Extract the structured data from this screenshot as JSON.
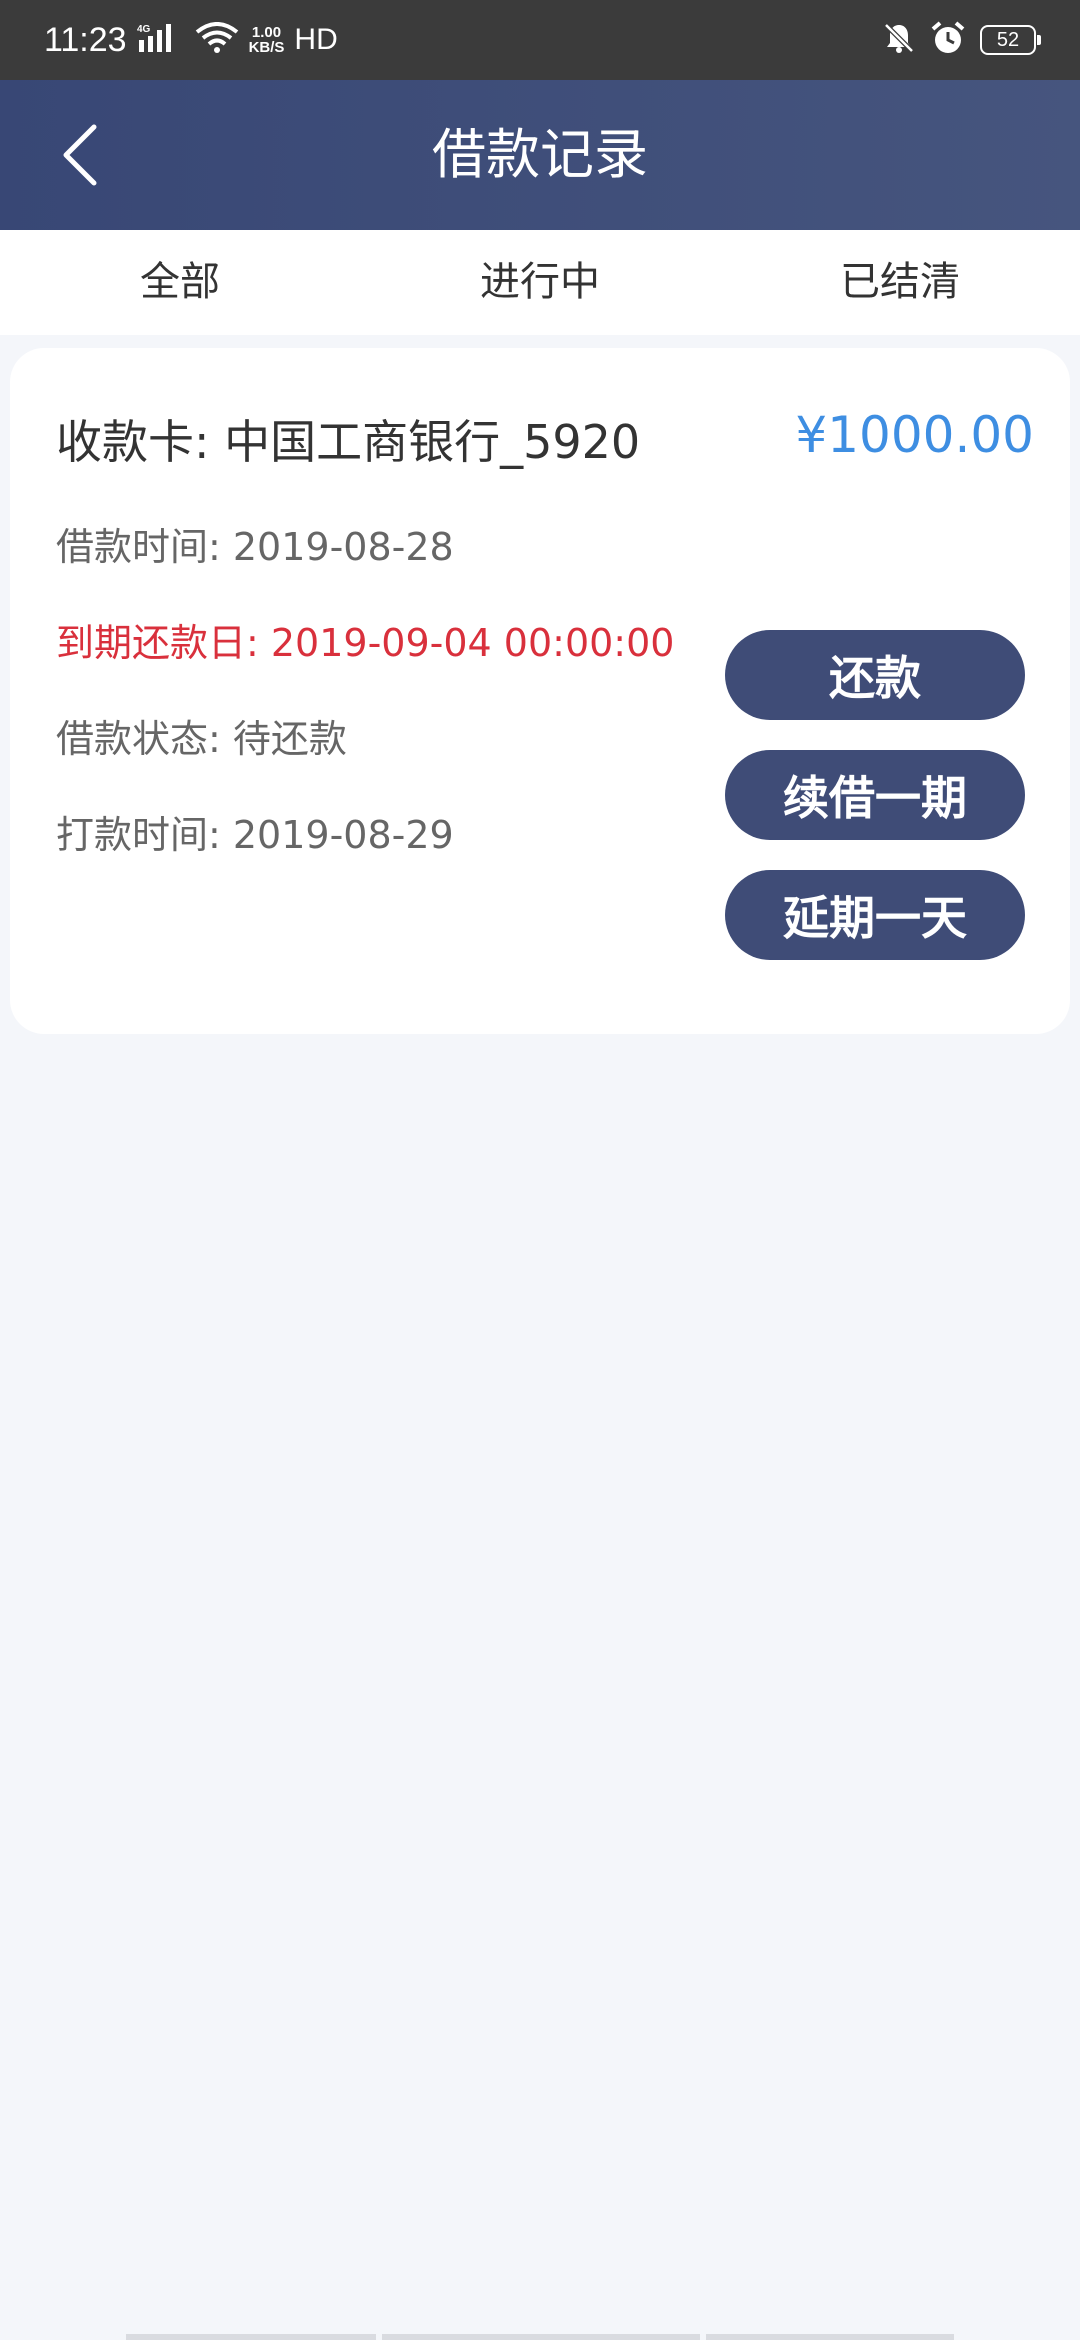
{
  "status_bar": {
    "time": "11:23",
    "network_type": "4G",
    "speed_value": "1.00",
    "speed_unit": "KB/S",
    "hd": "HD",
    "battery": "52"
  },
  "header": {
    "title": "借款记录"
  },
  "tabs": [
    {
      "label": "全部"
    },
    {
      "label": "进行中"
    },
    {
      "label": "已结清"
    }
  ],
  "record": {
    "card_label": "收款卡: 中国工商银行_5920",
    "amount": "¥1000.00",
    "loan_time": "借款时间: 2019-08-28",
    "due_date": "到期还款日: 2019-09-04 00:00:00",
    "status": "借款状态: 待还款",
    "transfer_time": "打款时间: 2019-08-29",
    "buttons": {
      "repay": "还款",
      "renew": "续借一期",
      "extend": "延期一天"
    }
  },
  "colors": {
    "header_bg": "#3d4b78",
    "amount": "#3e8ee2",
    "due_date": "#d9303c",
    "button_bg": "#3f4c77"
  },
  "icons": [
    "back-arrow-icon",
    "signal-icon",
    "wifi-icon",
    "mute-icon",
    "alarm-icon",
    "battery-icon"
  ]
}
